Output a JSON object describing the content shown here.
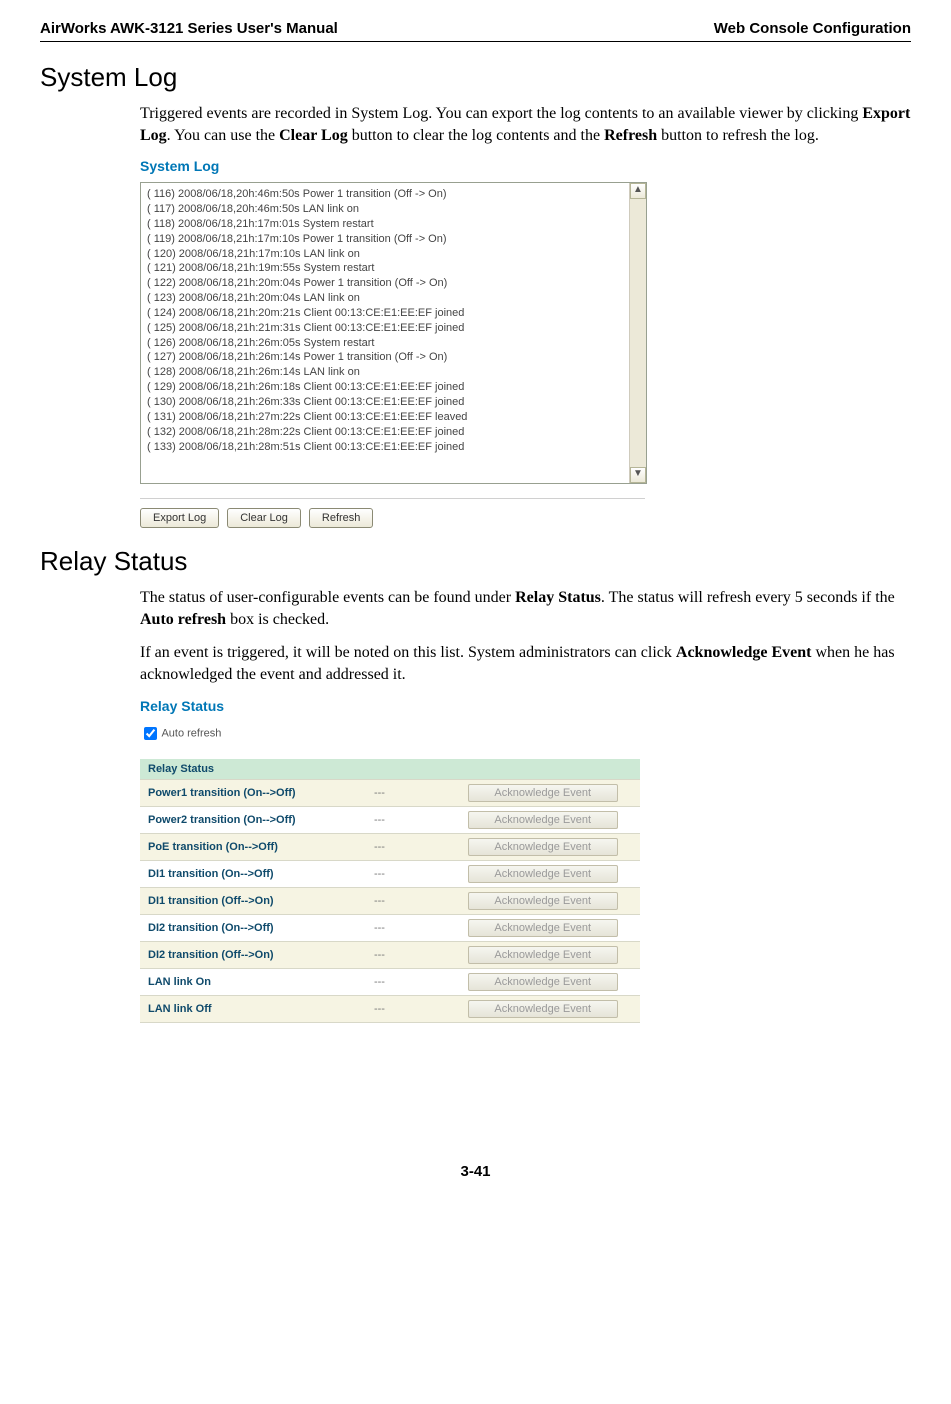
{
  "header": {
    "left": "AirWorks AWK-3121 Series User's Manual",
    "right": "Web Console Configuration"
  },
  "section1": {
    "title": "System Log",
    "paragraph_parts": {
      "p1a": "Triggered events are recorded in System Log. You can export the log contents to an available viewer by clicking ",
      "p1b": "Export Log",
      "p1c": ". You can use the ",
      "p1d": "Clear Log",
      "p1e": " button to clear the log contents and the ",
      "p1f": "Refresh",
      "p1g": " button to refresh the log."
    },
    "panel_title": "System Log",
    "log_lines": "( 116) 2008/06/18,20h:46m:50s Power 1 transition (Off -> On)\n( 117) 2008/06/18,20h:46m:50s LAN link on\n( 118) 2008/06/18,21h:17m:01s System restart\n( 119) 2008/06/18,21h:17m:10s Power 1 transition (Off -> On)\n( 120) 2008/06/18,21h:17m:10s LAN link on\n( 121) 2008/06/18,21h:19m:55s System restart\n( 122) 2008/06/18,21h:20m:04s Power 1 transition (Off -> On)\n( 123) 2008/06/18,21h:20m:04s LAN link on\n( 124) 2008/06/18,21h:20m:21s Client 00:13:CE:E1:EE:EF joined\n( 125) 2008/06/18,21h:21m:31s Client 00:13:CE:E1:EE:EF joined\n( 126) 2008/06/18,21h:26m:05s System restart\n( 127) 2008/06/18,21h:26m:14s Power 1 transition (Off -> On)\n( 128) 2008/06/18,21h:26m:14s LAN link on\n( 129) 2008/06/18,21h:26m:18s Client 00:13:CE:E1:EE:EF joined\n( 130) 2008/06/18,21h:26m:33s Client 00:13:CE:E1:EE:EF joined\n( 131) 2008/06/18,21h:27m:22s Client 00:13:CE:E1:EE:EF leaved\n( 132) 2008/06/18,21h:28m:22s Client 00:13:CE:E1:EE:EF joined\n( 133) 2008/06/18,21h:28m:51s Client 00:13:CE:E1:EE:EF joined",
    "buttons": {
      "export": "Export Log",
      "clear": "Clear Log",
      "refresh": "Refresh"
    }
  },
  "section2": {
    "title": "Relay Status",
    "paragraph1_parts": {
      "a": "The status of user-configurable events can be found under ",
      "b": "Relay Status",
      "c": ". The status will refresh every 5 seconds if the ",
      "d": "Auto refresh",
      "e": " box is checked."
    },
    "paragraph2_parts": {
      "a": "If an event is triggered, it will be noted on this list. System administrators can click ",
      "b": "Acknowledge Event",
      "c": " when he has acknowledged the event and addressed it."
    },
    "panel_title": "Relay Status",
    "auto_refresh_label": "Auto refresh",
    "table_header": "Relay Status",
    "ack_label": "Acknowledge Event",
    "dash": "---",
    "rows": [
      "Power1 transition (On-->Off)",
      "Power2 transition (On-->Off)",
      "PoE transition (On-->Off)",
      "DI1 transition (On-->Off)",
      "DI1 transition (Off-->On)",
      "DI2 transition (On-->Off)",
      "DI2 transition (Off-->On)",
      "LAN link On",
      "LAN link Off"
    ]
  },
  "footer": "3-41"
}
